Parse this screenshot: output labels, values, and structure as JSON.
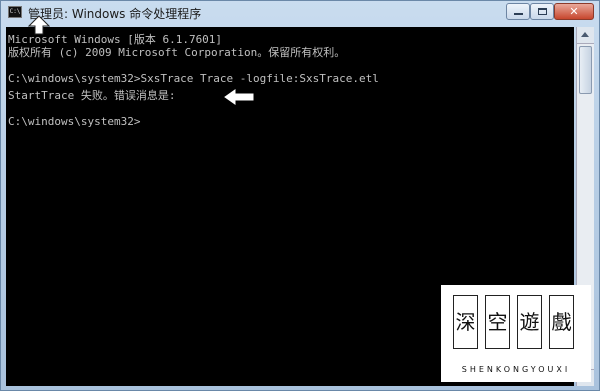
{
  "window": {
    "title": "管理员: Windows 命令处理程序"
  },
  "console": {
    "lines": [
      "Microsoft Windows [版本 6.1.7601]",
      "版权所有 (c) 2009 Microsoft Corporation。保留所有权利。",
      "",
      "C:\\windows\\system32>SxsTrace Trace -logfile:SxsTrace.etl",
      "StartTrace 失败。错误消息是:",
      "",
      "C:\\windows\\system32>"
    ]
  },
  "icons": {
    "app": "cmd-icon",
    "minimize": "minimize-icon",
    "maximize": "maximize-icon",
    "close": "close-icon",
    "annotation_up": "up-arrow-icon",
    "annotation_left": "left-arrow-icon"
  },
  "watermark": {
    "chars": [
      "深",
      "空",
      "遊",
      "戲"
    ],
    "sub": "SHENKONGYOUXI"
  }
}
